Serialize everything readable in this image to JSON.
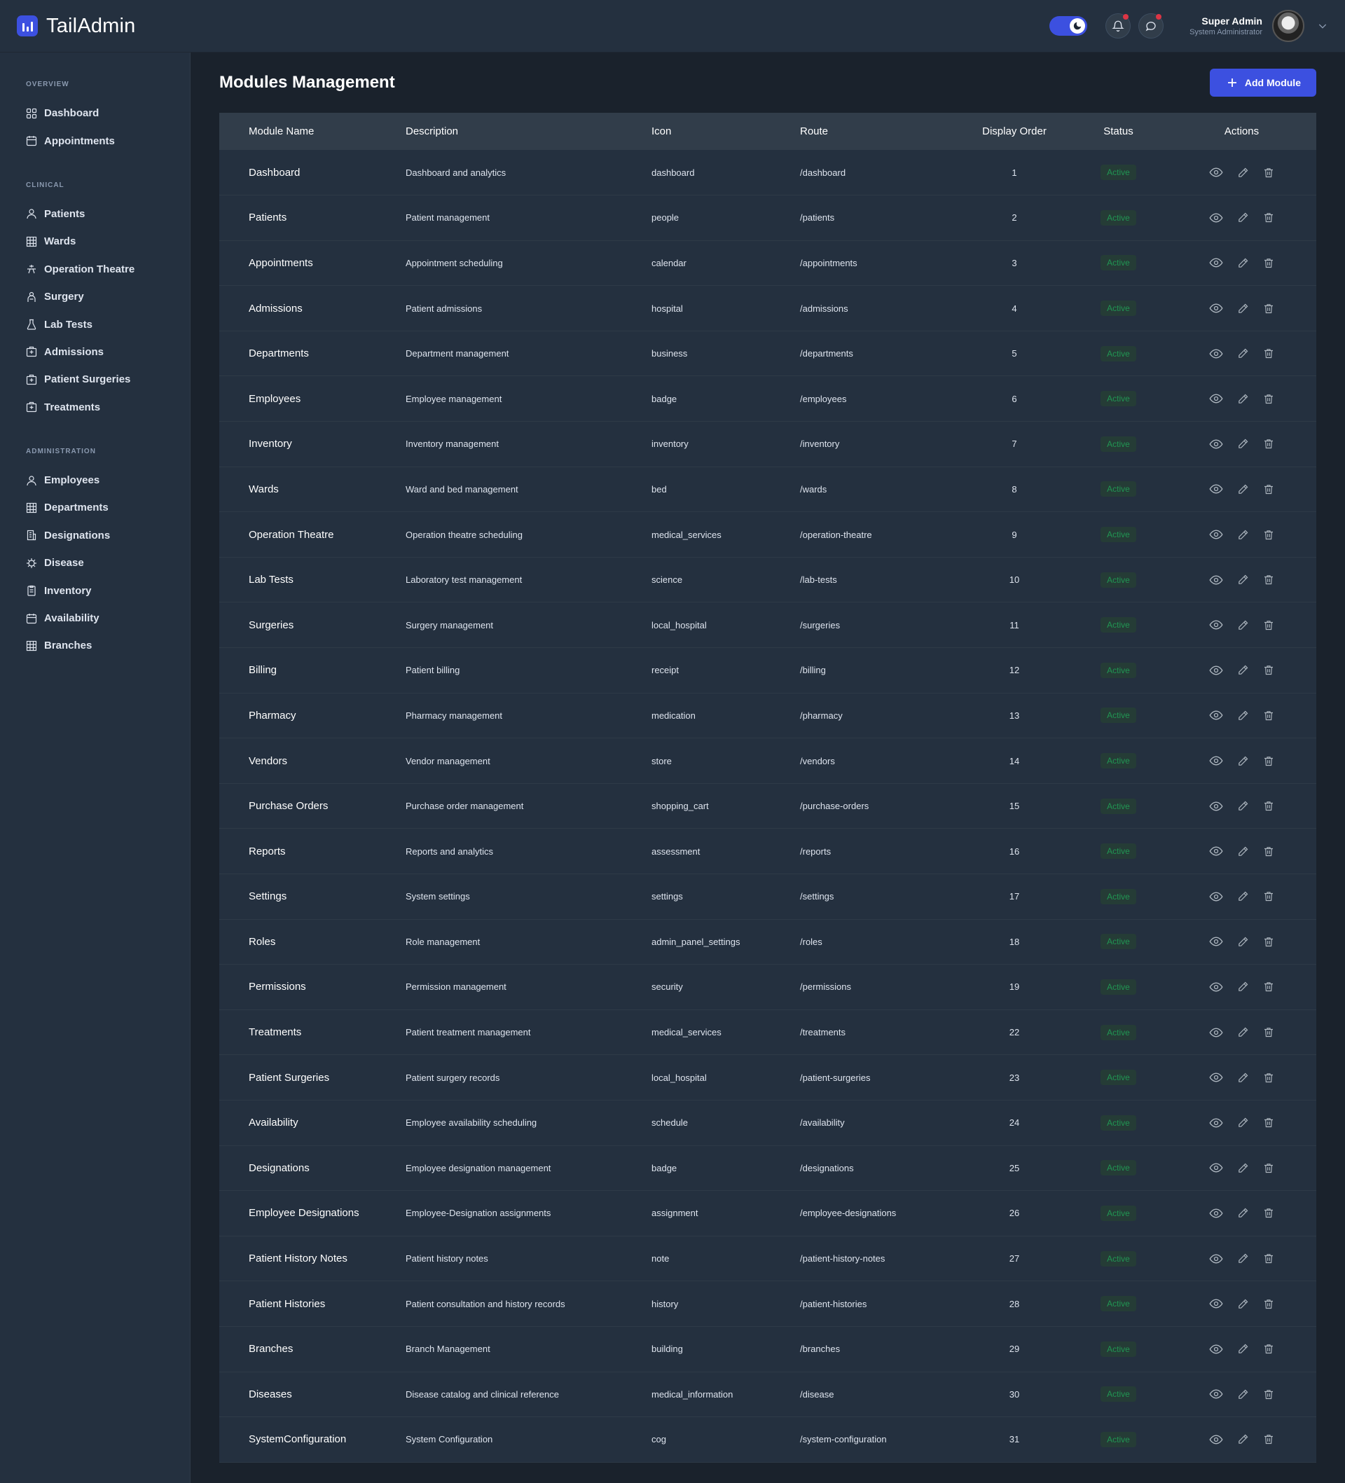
{
  "app": {
    "name": "TailAdmin"
  },
  "header": {
    "user_name": "Super Admin",
    "user_role": "System Administrator"
  },
  "sidebar": {
    "sections": [
      {
        "title": "OVERVIEW",
        "items": [
          {
            "label": "Dashboard",
            "icon": "grid-icon"
          },
          {
            "label": "Appointments",
            "icon": "calendar-icon"
          }
        ]
      },
      {
        "title": "CLINICAL",
        "items": [
          {
            "label": "Patients",
            "icon": "person-icon"
          },
          {
            "label": "Wards",
            "icon": "table-icon"
          },
          {
            "label": "Operation Theatre",
            "icon": "theatre-icon"
          },
          {
            "label": "Surgery",
            "icon": "surgery-icon"
          },
          {
            "label": "Lab Tests",
            "icon": "flask-icon"
          },
          {
            "label": "Admissions",
            "icon": "hospital-icon"
          },
          {
            "label": "Patient Surgeries",
            "icon": "hospital-icon"
          },
          {
            "label": "Treatments",
            "icon": "hospital-icon"
          }
        ]
      },
      {
        "title": "ADMINISTRATION",
        "items": [
          {
            "label": "Employees",
            "icon": "person-icon"
          },
          {
            "label": "Departments",
            "icon": "table-icon"
          },
          {
            "label": "Designations",
            "icon": "building-icon"
          },
          {
            "label": "Disease",
            "icon": "virus-icon"
          },
          {
            "label": "Inventory",
            "icon": "clipboard-icon"
          },
          {
            "label": "Availability",
            "icon": "calendar-icon"
          },
          {
            "label": "Branches",
            "icon": "table-icon"
          }
        ]
      }
    ]
  },
  "page": {
    "title": "Modules Management",
    "add_button": "Add Module"
  },
  "table": {
    "columns": [
      "Module Name",
      "Description",
      "Icon",
      "Route",
      "Display Order",
      "Status",
      "Actions"
    ],
    "rows": [
      {
        "name": "Dashboard",
        "description": "Dashboard and analytics",
        "icon": "dashboard",
        "route": "/dashboard",
        "order": "1",
        "status": "Active"
      },
      {
        "name": "Patients",
        "description": "Patient management",
        "icon": "people",
        "route": "/patients",
        "order": "2",
        "status": "Active"
      },
      {
        "name": "Appointments",
        "description": "Appointment scheduling",
        "icon": "calendar",
        "route": "/appointments",
        "order": "3",
        "status": "Active"
      },
      {
        "name": "Admissions",
        "description": "Patient admissions",
        "icon": "hospital",
        "route": "/admissions",
        "order": "4",
        "status": "Active"
      },
      {
        "name": "Departments",
        "description": "Department management",
        "icon": "business",
        "route": "/departments",
        "order": "5",
        "status": "Active"
      },
      {
        "name": "Employees",
        "description": "Employee management",
        "icon": "badge",
        "route": "/employees",
        "order": "6",
        "status": "Active"
      },
      {
        "name": "Inventory",
        "description": "Inventory management",
        "icon": "inventory",
        "route": "/inventory",
        "order": "7",
        "status": "Active"
      },
      {
        "name": "Wards",
        "description": "Ward and bed management",
        "icon": "bed",
        "route": "/wards",
        "order": "8",
        "status": "Active"
      },
      {
        "name": "Operation Theatre",
        "description": "Operation theatre scheduling",
        "icon": "medical_services",
        "route": "/operation-theatre",
        "order": "9",
        "status": "Active"
      },
      {
        "name": "Lab Tests",
        "description": "Laboratory test management",
        "icon": "science",
        "route": "/lab-tests",
        "order": "10",
        "status": "Active"
      },
      {
        "name": "Surgeries",
        "description": "Surgery management",
        "icon": "local_hospital",
        "route": "/surgeries",
        "order": "11",
        "status": "Active"
      },
      {
        "name": "Billing",
        "description": "Patient billing",
        "icon": "receipt",
        "route": "/billing",
        "order": "12",
        "status": "Active"
      },
      {
        "name": "Pharmacy",
        "description": "Pharmacy management",
        "icon": "medication",
        "route": "/pharmacy",
        "order": "13",
        "status": "Active"
      },
      {
        "name": "Vendors",
        "description": "Vendor management",
        "icon": "store",
        "route": "/vendors",
        "order": "14",
        "status": "Active"
      },
      {
        "name": "Purchase Orders",
        "description": "Purchase order management",
        "icon": "shopping_cart",
        "route": "/purchase-orders",
        "order": "15",
        "status": "Active"
      },
      {
        "name": "Reports",
        "description": "Reports and analytics",
        "icon": "assessment",
        "route": "/reports",
        "order": "16",
        "status": "Active"
      },
      {
        "name": "Settings",
        "description": "System settings",
        "icon": "settings",
        "route": "/settings",
        "order": "17",
        "status": "Active"
      },
      {
        "name": "Roles",
        "description": "Role management",
        "icon": "admin_panel_settings",
        "route": "/roles",
        "order": "18",
        "status": "Active"
      },
      {
        "name": "Permissions",
        "description": "Permission management",
        "icon": "security",
        "route": "/permissions",
        "order": "19",
        "status": "Active"
      },
      {
        "name": "Treatments",
        "description": "Patient treatment management",
        "icon": "medical_services",
        "route": "/treatments",
        "order": "22",
        "status": "Active"
      },
      {
        "name": "Patient Surgeries",
        "description": "Patient surgery records",
        "icon": "local_hospital",
        "route": "/patient-surgeries",
        "order": "23",
        "status": "Active"
      },
      {
        "name": "Availability",
        "description": "Employee availability scheduling",
        "icon": "schedule",
        "route": "/availability",
        "order": "24",
        "status": "Active"
      },
      {
        "name": "Designations",
        "description": "Employee designation management",
        "icon": "badge",
        "route": "/designations",
        "order": "25",
        "status": "Active"
      },
      {
        "name": "Employee Designations",
        "description": "Employee-Designation assignments",
        "icon": "assignment",
        "route": "/employee-designations",
        "order": "26",
        "status": "Active"
      },
      {
        "name": "Patient History Notes",
        "description": "Patient history notes",
        "icon": "note",
        "route": "/patient-history-notes",
        "order": "27",
        "status": "Active"
      },
      {
        "name": "Patient Histories",
        "description": "Patient consultation and history records",
        "icon": "history",
        "route": "/patient-histories",
        "order": "28",
        "status": "Active"
      },
      {
        "name": "Branches",
        "description": "Branch Management",
        "icon": "building",
        "route": "/branches",
        "order": "29",
        "status": "Active"
      },
      {
        "name": "Diseases",
        "description": "Disease catalog and clinical reference",
        "icon": "medical_information",
        "route": "/disease",
        "order": "30",
        "status": "Active"
      },
      {
        "name": "SystemConfiguration",
        "description": "System Configuration",
        "icon": "cog",
        "route": "/system-configuration",
        "order": "31",
        "status": "Active"
      }
    ]
  },
  "colors": {
    "primary": "#3C50E0",
    "success": "#219653",
    "sidebar_bg": "#24303F",
    "body_bg": "#1A222C"
  }
}
